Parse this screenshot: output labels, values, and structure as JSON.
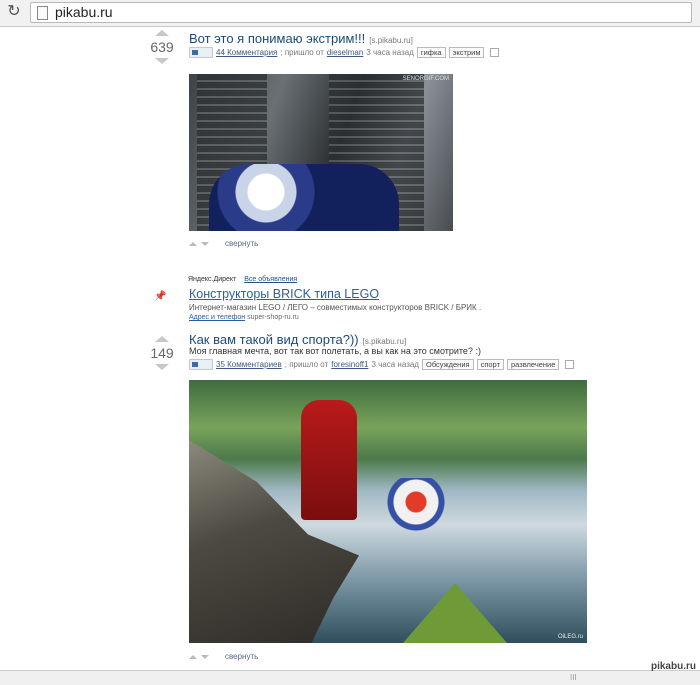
{
  "browser": {
    "url": "pikabu.ru"
  },
  "posts": [
    {
      "score": "639",
      "title": "Вот это я понимаю экстрим!!!",
      "source": "[s.pikabu.ru]",
      "comments": "44 Комментария",
      "meta_text": "; пришло от",
      "author": "dieselman",
      "time": "3 часа назад",
      "tags": [
        "гифка",
        "экстрим"
      ],
      "image_watermark": "SENORGIF.COM",
      "collapse": "свернуть"
    },
    {
      "score": "149",
      "title": "Как вам такой вид спорта?))",
      "source": "[s.pikabu.ru]",
      "description": "Моя главная мечта, вот так вот полетать, а вы как на это смотрите? :)",
      "comments": "35 Комментариев",
      "meta_text": "; пришло от",
      "author": "foresinoff1",
      "time": "3 часа назад",
      "tags": [
        "Обсуждения",
        "спорт",
        "развлечение"
      ],
      "image_watermark": "OiLEG.ru",
      "collapse": "свернуть"
    }
  ],
  "ad": {
    "label": "Яндекс.Директ",
    "all_ads": "Все объявления",
    "title": "Конструкторы BRICK типа LEGO",
    "text": "Интернет-магазин LEGO / ЛЕГО – совместимых конструкторов BRICK / БРИК .",
    "address_link": "Адрес и телефон",
    "site": "super-shop-ru.ru"
  },
  "status": {
    "grip": "III",
    "watermark": "pikabu.ru"
  },
  "icons": {
    "reload": "reload-icon",
    "page": "page-icon"
  }
}
